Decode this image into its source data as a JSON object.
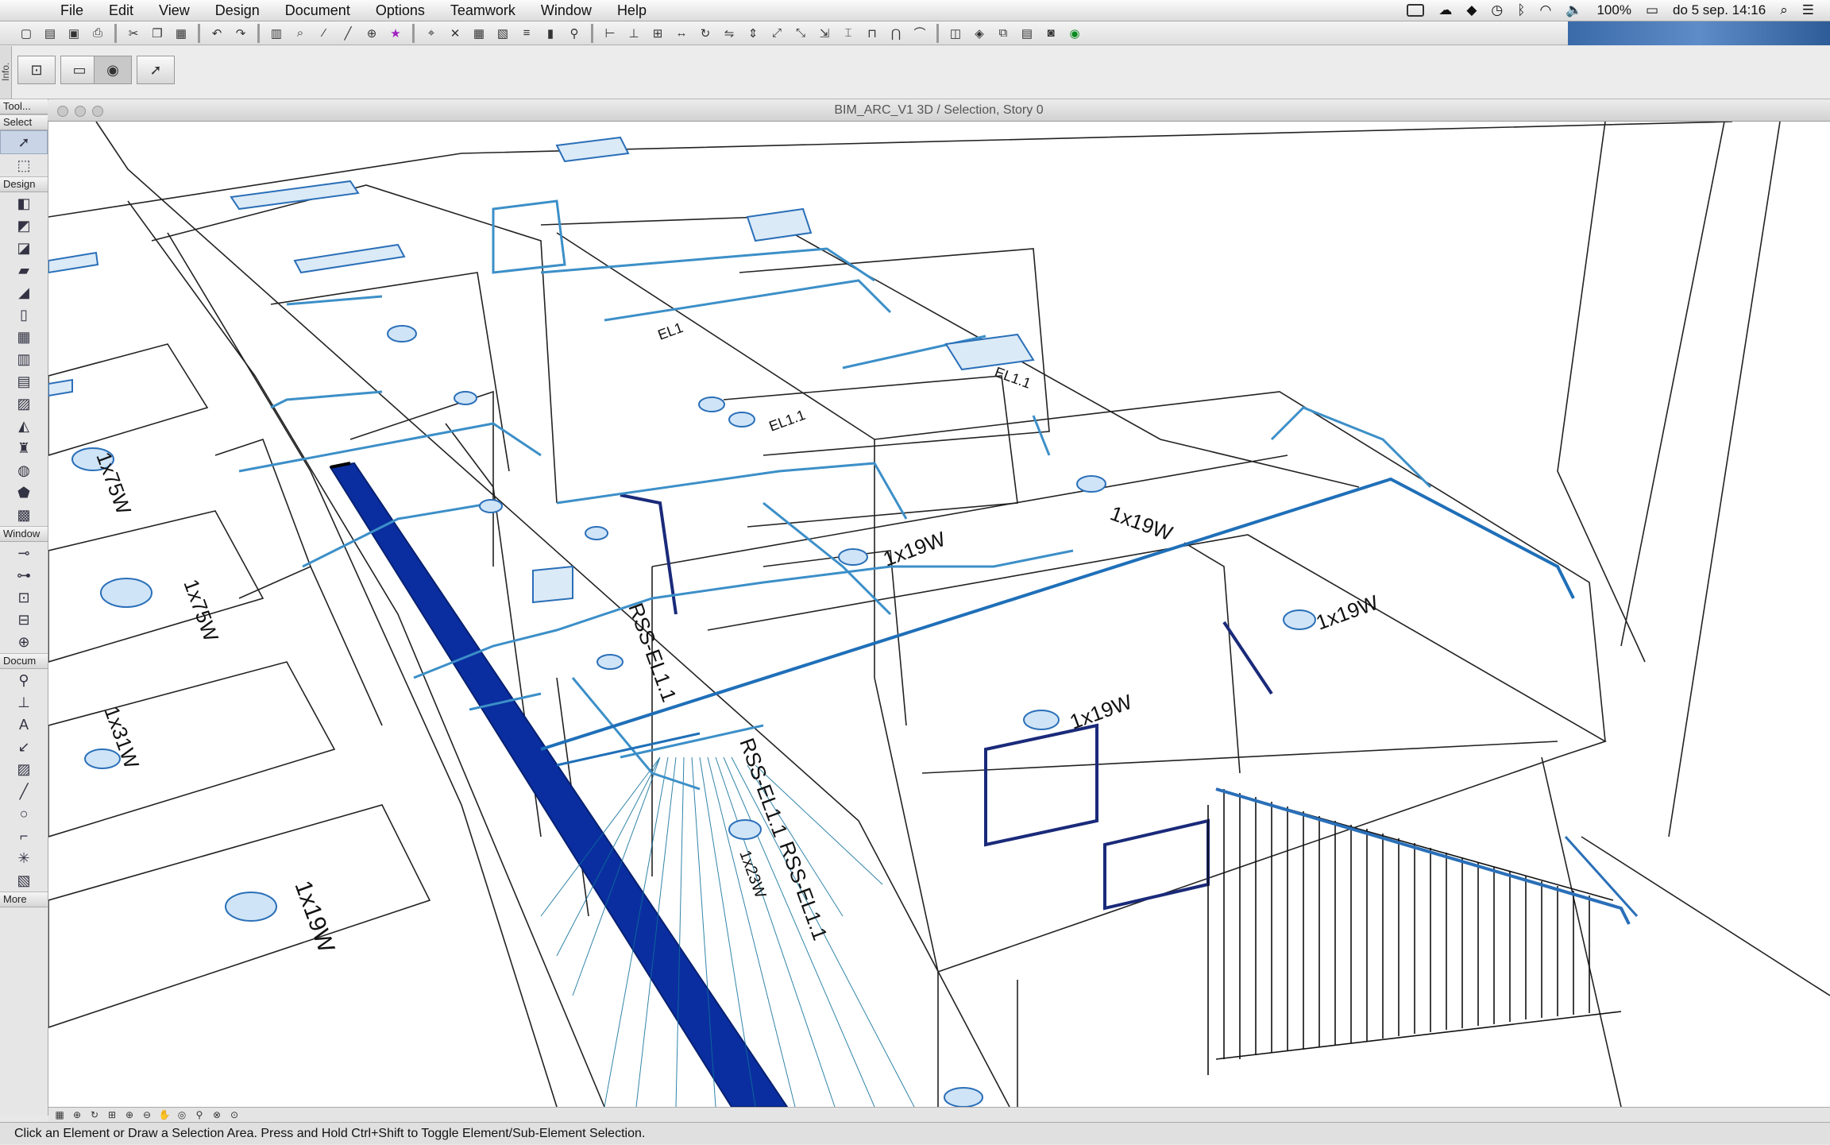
{
  "menubar": {
    "apple": "",
    "items": [
      "File",
      "Edit",
      "View",
      "Design",
      "Document",
      "Options",
      "Teamwork",
      "Window",
      "Help"
    ],
    "battery": "100%",
    "datetime": "do 5 sep.  14:16"
  },
  "info_strip": "Info.",
  "palette": {
    "tool_header": "Tool...",
    "sections": {
      "select": "Select",
      "design": "Design",
      "window": "Window",
      "document": "Docum",
      "more": "More"
    }
  },
  "window": {
    "title": "BIM_ARC_V1 3D / Selection, Story 0"
  },
  "model_labels": {
    "l1": "1x19W",
    "l2": "1x19W",
    "l3": "1x19W",
    "l4": "1x19W",
    "l5": "1x75W",
    "l6": "1x75W",
    "l7": "1x31W",
    "l8": "RSS-EL1.1",
    "l9": "1x23W",
    "l10": "RSS-EL1.1",
    "l11": "1x19W",
    "l12": "RSS-EL1.1",
    "l13": "EL1",
    "l14": "EL1.1",
    "l15": "EL1.1"
  },
  "status": {
    "message": "Click an Element or Draw a Selection Area. Press and Hold Ctrl+Shift to Toggle Element/Sub-Element Selection."
  }
}
